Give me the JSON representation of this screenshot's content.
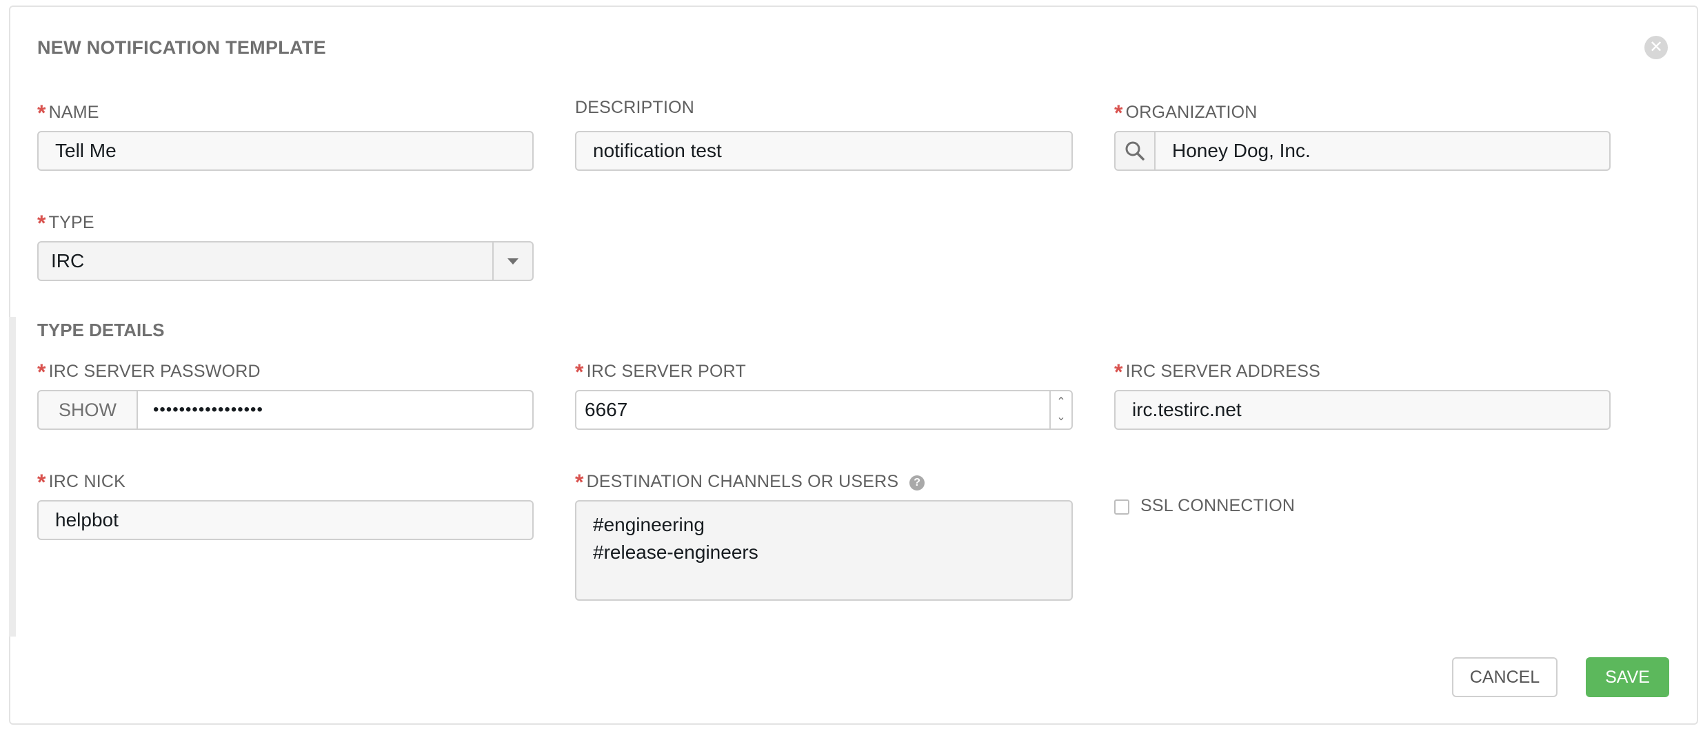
{
  "header": {
    "title": "NEW NOTIFICATION TEMPLATE",
    "close_glyph": "✕"
  },
  "required_marker": "*",
  "fields": {
    "name": {
      "label": "NAME",
      "value": "Tell Me"
    },
    "description": {
      "label": "DESCRIPTION",
      "value": "notification test"
    },
    "organization": {
      "label": "ORGANIZATION",
      "value": "Honey Dog, Inc."
    },
    "type": {
      "label": "TYPE",
      "value": "IRC"
    }
  },
  "type_details": {
    "section_title": "TYPE DETAILS",
    "irc_server_password": {
      "label": "IRC SERVER PASSWORD",
      "show_label": "SHOW",
      "masked_value": "•••••••••••••••••"
    },
    "irc_server_port": {
      "label": "IRC SERVER PORT",
      "value": "6667"
    },
    "irc_server_address": {
      "label": "IRC SERVER ADDRESS",
      "value": "irc.testirc.net"
    },
    "irc_nick": {
      "label": "IRC NICK",
      "value": "helpbot"
    },
    "destination": {
      "label": "DESTINATION CHANNELS OR USERS",
      "help_glyph": "?",
      "lines": [
        "#engineering",
        "#release-engineers"
      ]
    },
    "ssl_connection": {
      "label": "SSL CONNECTION",
      "checked": false
    }
  },
  "actions": {
    "cancel_label": "CANCEL",
    "save_label": "SAVE"
  },
  "colors": {
    "required": "#d9534f",
    "save": "#5cb85c",
    "label": "#606060"
  }
}
